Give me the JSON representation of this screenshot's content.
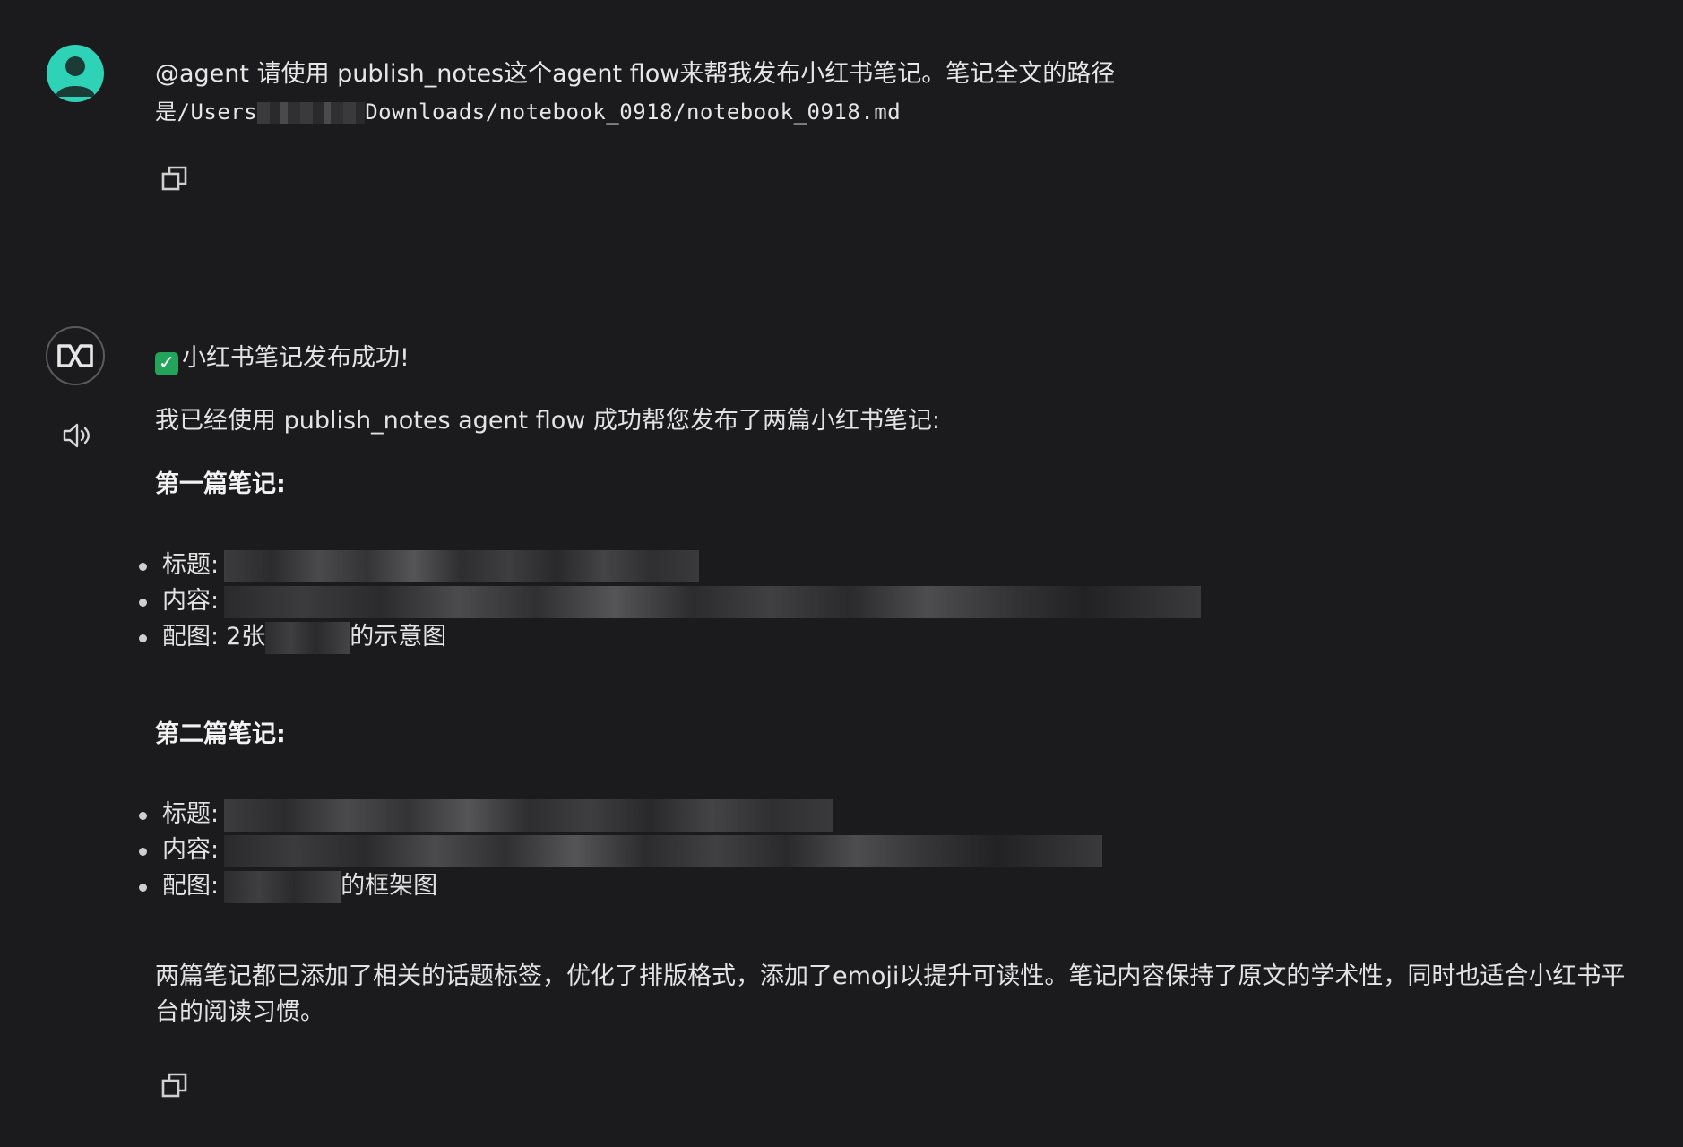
{
  "user_message": {
    "line1": "@agent 请使用 publish_notes这个agent flow来帮我发布小红书笔记。笔记全文的路径",
    "line2_prefix": "是/Users",
    "line2_suffix": "Downloads/notebook_0918/notebook_0918.md"
  },
  "agent_reply": {
    "headline": "小红书笔记发布成功!",
    "intro": "我已经使用 publish_notes agent flow 成功帮您发布了两篇小红书笔记:",
    "note1": {
      "heading": "第一篇笔记:",
      "title_label": "标题:",
      "content_label": "内容:",
      "image_label": "配图:",
      "image_prefix": "2张",
      "image_suffix": "的示意图"
    },
    "note2": {
      "heading": "第二篇笔记:",
      "title_label": "标题:",
      "content_label": "内容:",
      "image_label": "配图:",
      "image_suffix": "的框架图"
    },
    "summary": "两篇笔记都已添加了相关的话题标签，优化了排版格式，添加了emoji以提升可读性。笔记内容保持了原文的学术性，同时也适合小红书平台的阅读习惯。"
  },
  "icons": {
    "user_avatar": "user-avatar-icon",
    "agent_avatar": "agent-logo-icon",
    "copy": "copy-icon",
    "speaker": "speaker-icon"
  },
  "colors": {
    "background": "#1b1b1d",
    "user_avatar": "#2ed3b7",
    "check": "#22a45a"
  }
}
